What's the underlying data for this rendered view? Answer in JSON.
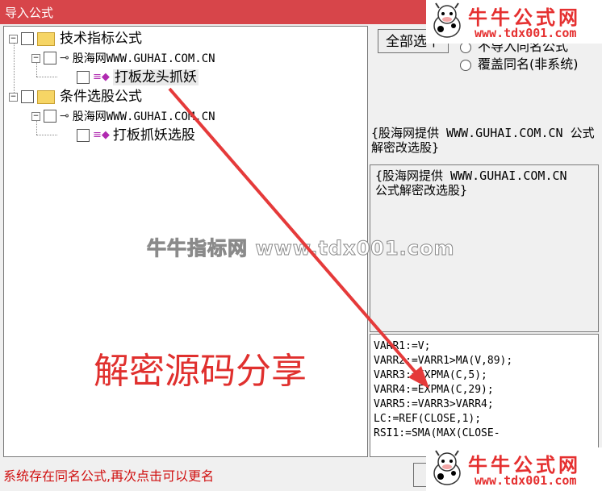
{
  "window": {
    "title": "导入公式"
  },
  "tree": {
    "nodes": [
      {
        "label": "技术指标公式"
      },
      {
        "label": "股海网WWW.GUHAI.COM.CN"
      },
      {
        "label": "打板龙头抓妖"
      },
      {
        "label": "条件选股公式"
      },
      {
        "label": "股海网WWW.GUHAI.COM.CN"
      },
      {
        "label": "打板抓妖选股"
      }
    ]
  },
  "right": {
    "select_all_label": "全部选中",
    "radio1_label": "不导入同名公式",
    "radio2_label": "覆盖同名(非系统)",
    "info_text": "{股海网提供 WWW.GUHAI.COM.CN 公式解密改选股}",
    "desc_text": "{股海网提供 WWW.GUHAI.COM.CN\n公式解密改选股}",
    "code_lines": [
      "VARR1:=V;",
      "VARR2:=VARR1>MA(V,89);",
      "VARR3:=EXPMA(C,5);",
      "VARR4:=EXPMA(C,29);",
      "VARR5:=VARR3>VARR4;",
      "LC:=REF(CLOSE,1);",
      "RSI1:=SMA(MAX(CLOSE-"
    ]
  },
  "status": {
    "message": "系统存在同名公式,再次点击可以更名"
  },
  "overlays": {
    "watermark": "牛牛指标网 www.tdx001.com",
    "promo_text": "解密源码分享",
    "logo_title": "牛牛公式网",
    "logo_url": "www.tdx001.com"
  },
  "colors": {
    "titlebar": "#d7454a",
    "accent_red": "#e0302e",
    "gem": "#b02ab0"
  }
}
